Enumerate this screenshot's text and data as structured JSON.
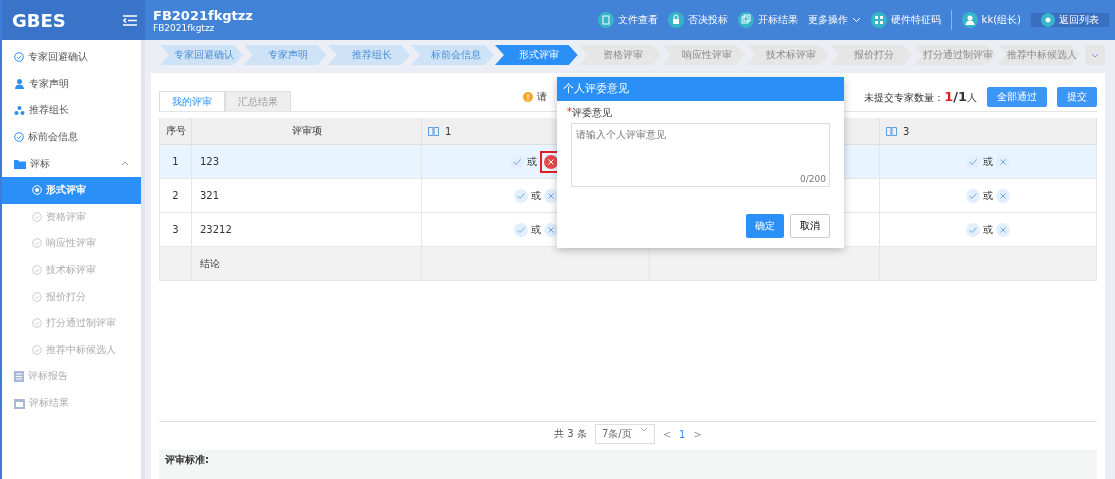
{
  "header": {
    "logo": "GBES",
    "project_title": "FB2021fkgtzz",
    "project_code": "FB2021fkgtzz",
    "actions": [
      {
        "label": "文件查看",
        "kind": "file"
      },
      {
        "label": "否决投标",
        "kind": "lock"
      },
      {
        "label": "开标结果",
        "kind": "copy"
      },
      {
        "label": "更多操作",
        "kind": "menu"
      },
      {
        "label": "硬件特征码",
        "kind": "grid"
      }
    ],
    "user": "kk(组长)",
    "back": "返回列表"
  },
  "sidebar": {
    "items": [
      {
        "label": "专家回避确认",
        "kind": "status",
        "selected": false,
        "disabled": false
      },
      {
        "label": "专家声明",
        "kind": "person",
        "selected": false,
        "disabled": false
      },
      {
        "label": "推荐组长",
        "kind": "group",
        "selected": false,
        "disabled": false
      },
      {
        "label": "标前会信息",
        "kind": "status",
        "selected": false,
        "disabled": false
      },
      {
        "label": "评标",
        "kind": "folder",
        "selected": false,
        "disabled": false,
        "expanded": true,
        "children": [
          {
            "label": "形式评审",
            "kind": "radio",
            "selected": true,
            "disabled": false
          },
          {
            "label": "资格评审",
            "kind": "status",
            "selected": false,
            "disabled": true
          },
          {
            "label": "响应性评审",
            "kind": "status",
            "selected": false,
            "disabled": true
          },
          {
            "label": "技术标评审",
            "kind": "status",
            "selected": false,
            "disabled": true
          },
          {
            "label": "报价打分",
            "kind": "status",
            "selected": false,
            "disabled": true
          },
          {
            "label": "打分通过制评审",
            "kind": "status",
            "selected": false,
            "disabled": true
          },
          {
            "label": "推荐中标候选人",
            "kind": "status",
            "selected": false,
            "disabled": true
          }
        ]
      },
      {
        "label": "评标报告",
        "kind": "doc",
        "selected": false,
        "disabled": true
      },
      {
        "label": "评标结果",
        "kind": "calendar",
        "selected": false,
        "disabled": true
      }
    ]
  },
  "steps": [
    {
      "label": "专家回避确认",
      "completed": true,
      "selected": false
    },
    {
      "label": "专家声明",
      "completed": true,
      "selected": false
    },
    {
      "label": "推荐组长",
      "completed": true,
      "selected": false
    },
    {
      "label": "标前会信息",
      "completed": true,
      "selected": false
    },
    {
      "label": "形式评审",
      "completed": false,
      "selected": true
    },
    {
      "label": "资格评审",
      "completed": false,
      "selected": false
    },
    {
      "label": "响应性评审",
      "completed": false,
      "selected": false
    },
    {
      "label": "技术标评审",
      "completed": false,
      "selected": false
    },
    {
      "label": "报价打分",
      "completed": false,
      "selected": false
    },
    {
      "label": "打分通过制评审",
      "completed": false,
      "selected": false
    },
    {
      "label": "推荐中标候选人",
      "completed": false,
      "selected": false
    }
  ],
  "panel": {
    "tabs": [
      {
        "label": "我的评审",
        "selected": true
      },
      {
        "label": "汇总结果",
        "selected": false
      }
    ],
    "notice": "请",
    "pending": {
      "label": "未提交专家数量：",
      "count": "1",
      "total": "/1",
      "unit": "人"
    },
    "buttons": [
      "全部通过",
      "提交"
    ],
    "table": {
      "columns": [
        "序号",
        "评审项"
      ],
      "expert_columns": [
        "1",
        "3"
      ],
      "rows": [
        {
          "index": "1",
          "item": "123",
          "selected": true,
          "results": [
            {
              "passed": false,
              "failed": true,
              "word": "或"
            },
            {
              "passed": false,
              "failed": false,
              "word": "或"
            }
          ]
        },
        {
          "index": "2",
          "item": "321",
          "selected": false,
          "results": [
            {
              "passed": false,
              "failed": false,
              "word": "或"
            },
            {
              "passed": false,
              "failed": false,
              "word": "或"
            }
          ]
        },
        {
          "index": "3",
          "item": "23212",
          "selected": false,
          "results": [
            {
              "passed": false,
              "failed": false,
              "word": "或"
            },
            {
              "passed": false,
              "failed": false,
              "word": "或"
            }
          ]
        }
      ],
      "conclusion": "结论"
    },
    "pagination": {
      "total": "共 3 条",
      "page_size": "7条/页",
      "prev": "<",
      "page": "1",
      "next": ">"
    },
    "criteria_title": "评审标准:"
  },
  "dialog": {
    "title": "个人评委意见",
    "required_mark": "*",
    "field_label": "评委意见",
    "placeholder": "请输入个人评审意见",
    "counter": "0/200",
    "buttons": [
      "确定",
      "取消"
    ]
  }
}
